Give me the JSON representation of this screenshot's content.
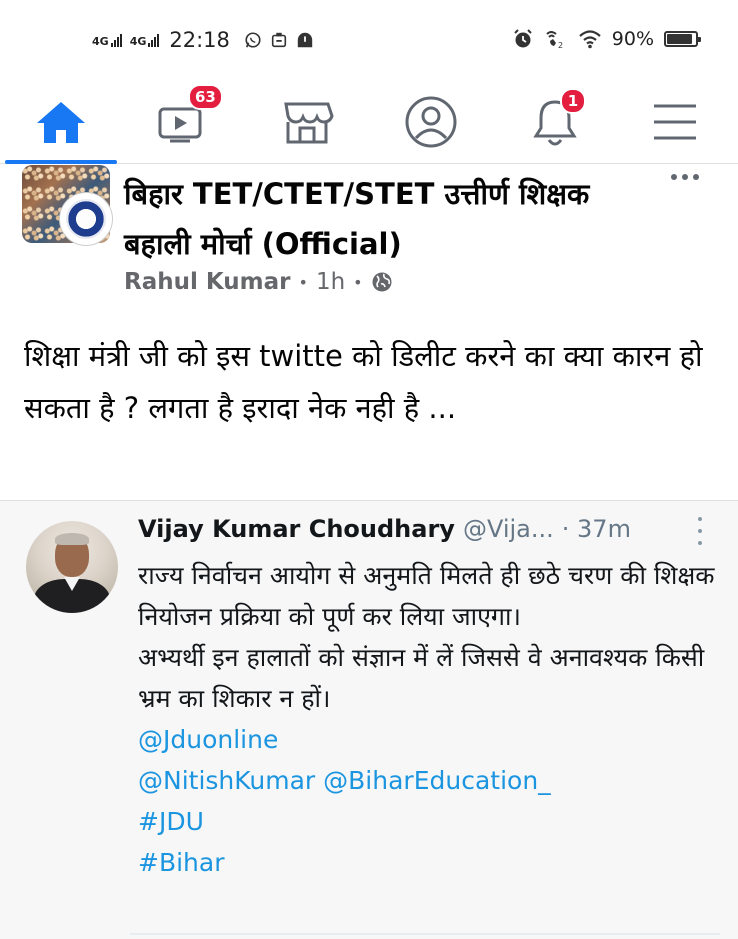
{
  "status_bar": {
    "net1": "4G",
    "net2": "4G",
    "time": "22:18",
    "battery": "90%",
    "battery_level": 0.9
  },
  "nav": {
    "active_tab": "home",
    "items": [
      {
        "name": "home",
        "icon": "home-icon",
        "badge": ""
      },
      {
        "name": "watch",
        "icon": "watch-icon",
        "badge": "63"
      },
      {
        "name": "marketplace",
        "icon": "marketplace-icon",
        "badge": ""
      },
      {
        "name": "profile",
        "icon": "profile-icon",
        "badge": ""
      },
      {
        "name": "notifications",
        "icon": "bell-icon",
        "badge": "1"
      },
      {
        "name": "menu",
        "icon": "hamburger-menu-icon",
        "badge": ""
      }
    ],
    "accent_color": "#1877f2",
    "badge_color": "#e41e3f"
  },
  "post": {
    "group_name": "बिहार TET/CTET/STET उत्तीर्ण शिक्षक बहाली मोर्चा (Official)",
    "author": "Rahul Kumar",
    "time": "1h",
    "text": "शिक्षा मंत्री जी को इस twitte को डिलीट करने का क्या कारन हो सकता है ? लगता है इरादा नेक नही है ..."
  },
  "tweet": {
    "name": "Vijay Kumar Choudhary",
    "handle": "@Vija...",
    "time": "· 37m",
    "body_lines": [
      "राज्य निर्वाचन आयोग से अनुमति मिलते ही छठे चरण की शिक्षक नियोजन प्रक्रिया को पूर्ण कर लिया जाएगा।",
      "अभ्यर्थी इन हालातों को संज्ञान में लें जिससे वे अनावश्यक किसी भ्रम का शिकार न हों।"
    ],
    "tags": [
      "@Jduonline",
      "@NitishKumar @BiharEducation_",
      "#JDU",
      "#Bihar"
    ],
    "link_color": "#1b95e0"
  }
}
